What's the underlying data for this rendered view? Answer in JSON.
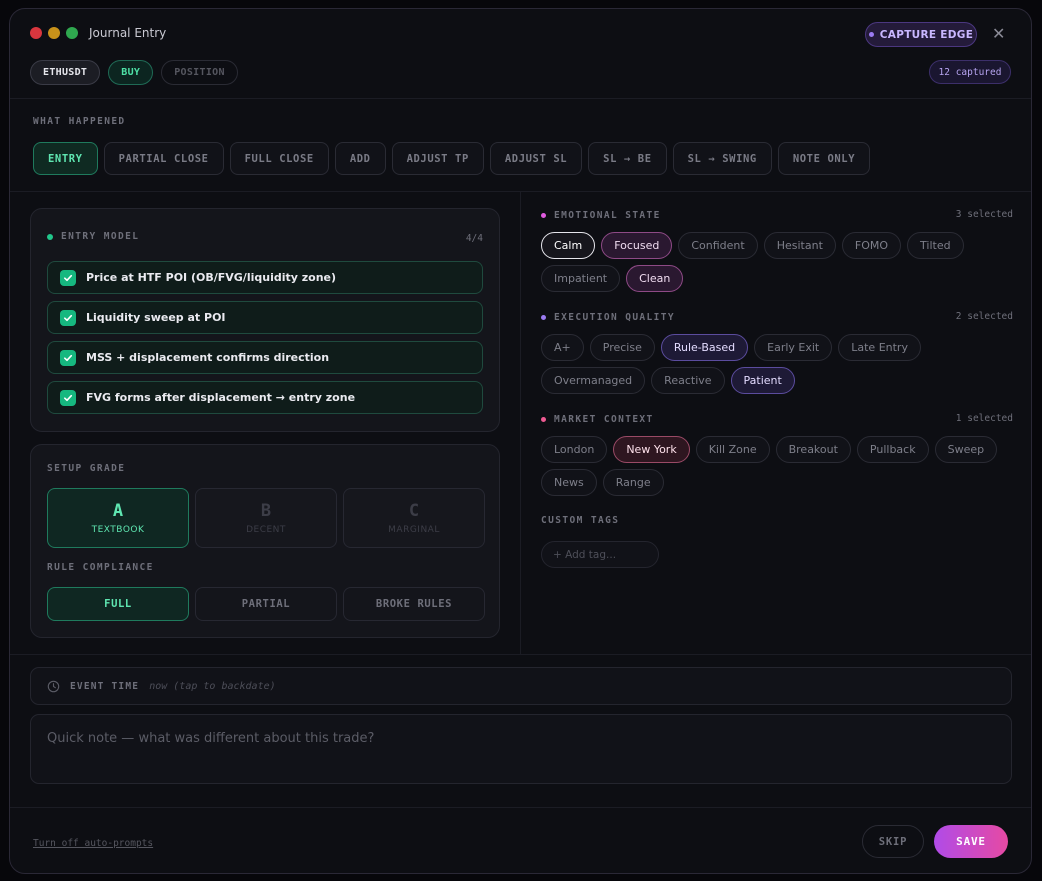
{
  "header": {
    "title": "Journal Entry",
    "edge_button": "CAPTURE EDGE",
    "close_glyph": "✕",
    "symbol": "ETHUSDT",
    "side": "BUY",
    "position": "POSITION",
    "captured": "12 captured"
  },
  "what_happened": {
    "label": "WHAT HAPPENED",
    "actions": [
      "ENTRY",
      "PARTIAL CLOSE",
      "FULL CLOSE",
      "ADD",
      "ADJUST TP",
      "ADJUST SL",
      "SL → BE",
      "SL → SWING",
      "NOTE ONLY"
    ],
    "active": "ENTRY"
  },
  "entry_model": {
    "label": "ENTRY MODEL",
    "count": "4/4",
    "items": [
      "Price at HTF POI (OB/FVG/liquidity zone)",
      "Liquidity sweep at POI",
      "MSS + displacement confirms direction",
      "FVG forms after displacement → entry zone"
    ]
  },
  "setup_grade": {
    "label": "SETUP GRADE",
    "grades": [
      {
        "letter": "A",
        "sub": "TEXTBOOK"
      },
      {
        "letter": "B",
        "sub": "DECENT"
      },
      {
        "letter": "C",
        "sub": "MARGINAL"
      }
    ],
    "active": "A"
  },
  "rule_compliance": {
    "label": "RULE COMPLIANCE",
    "options": [
      "FULL",
      "PARTIAL",
      "BROKE RULES"
    ],
    "active": "FULL"
  },
  "emotional_state": {
    "label": "EMOTIONAL STATE",
    "count": "3 selected",
    "color": "#e05be0",
    "tags": [
      "Calm",
      "Focused",
      "Confident",
      "Hesitant",
      "FOMO",
      "Tilted",
      "Impatient",
      "Clean"
    ],
    "selected": {
      "Calm": "white",
      "Focused": "pink",
      "Clean": "pink"
    }
  },
  "execution_quality": {
    "label": "EXECUTION QUALITY",
    "count": "2 selected",
    "color": "#9b7bf2",
    "tags": [
      "A+",
      "Precise",
      "Rule-Based",
      "Early Exit",
      "Late Entry",
      "Overmanaged",
      "Reactive",
      "Patient"
    ],
    "selected": {
      "Rule-Based": "violet",
      "Patient": "violet"
    }
  },
  "market_context": {
    "label": "MARKET CONTEXT",
    "count": "1 selected",
    "color": "#ee5a92",
    "tags": [
      "London",
      "New York",
      "Kill Zone",
      "Breakout",
      "Pullback",
      "Sweep",
      "News",
      "Range"
    ],
    "selected": {
      "New York": "rose"
    }
  },
  "custom_tags": {
    "label": "CUSTOM TAGS",
    "placeholder": "+ Add tag..."
  },
  "event_time": {
    "label": "EVENT TIME",
    "hint": "now (tap to backdate)"
  },
  "note": {
    "placeholder": "Quick note — what was different about this trade?"
  },
  "footer": {
    "auto_prompts": "Turn off auto-prompts",
    "skip": "SKIP",
    "save": "SAVE"
  }
}
